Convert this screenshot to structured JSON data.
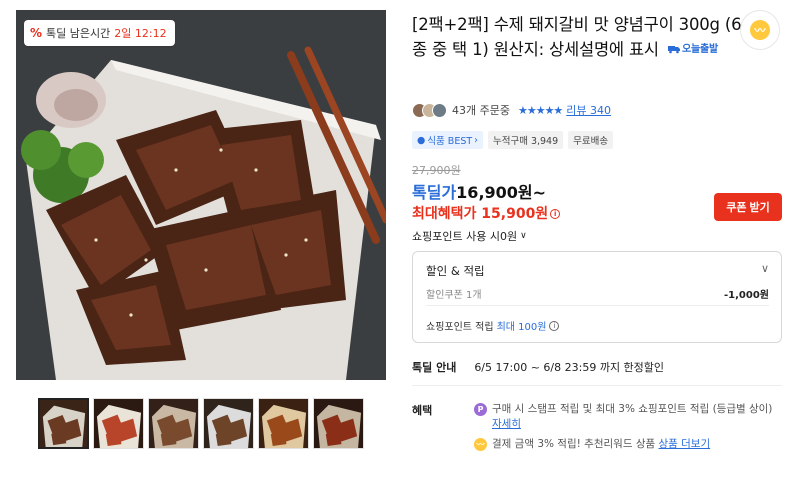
{
  "gallery": {
    "timer_label": "톡딜 남은시간",
    "timer_value": "2일 12:12",
    "thumbnails": [
      {
        "name": "thumb-1",
        "colors": [
          "#3a2418",
          "#6b3a22",
          "#d8d3c8"
        ]
      },
      {
        "name": "thumb-2",
        "colors": [
          "#2a1a12",
          "#b8442a",
          "#e9e3d8"
        ]
      },
      {
        "name": "thumb-3",
        "colors": [
          "#332018",
          "#7a4a2e",
          "#c9b9a4"
        ]
      },
      {
        "name": "thumb-4",
        "colors": [
          "#2f241c",
          "#6e4429",
          "#dcdcdc"
        ]
      },
      {
        "name": "thumb-5",
        "colors": [
          "#3b2112",
          "#9a4a1a",
          "#e0c9a0"
        ]
      },
      {
        "name": "thumb-6",
        "colors": [
          "#2a1812",
          "#8a2e18",
          "#c4b6a0"
        ]
      }
    ]
  },
  "product": {
    "title": "[2팩+2팩] 수제 돼지갈비 맛 양념구이 300g (6종 중 택 1) 원산지: 상세설명에 표시",
    "delivery_badge": "오늘출발",
    "order_count": "43개 주문중",
    "stars": "★★★★★",
    "review_link": "리뷰 340",
    "badges": [
      "식품 BEST",
      "누적구매 3,949",
      "무료배송"
    ],
    "original_price": "27,900원",
    "deal_label": "톡딜가",
    "deal_price": "16,900원~",
    "max_benefit_label": "최대혜택가",
    "max_benefit_price": "15,900원",
    "coupon_button": "쿠폰 받기",
    "points_use": "쇼핑포인트 사용 시0원"
  },
  "benefit_box": {
    "heading": "할인 & 적립",
    "coupon_label": "할인쿠폰 1개",
    "coupon_value": "-1,000원",
    "points_label": "쇼핑포인트 적립",
    "points_value": "최대 100원"
  },
  "deal_info": {
    "label": "톡딜 안내",
    "text": "6/5 17:00 ~ 6/8 23:59 까지 한정할인"
  },
  "benefits": {
    "label": "혜택",
    "item1_text": "구매 시 스탬프 적립 및 최대 3% 쇼핑포인트 적립 (등급별 상이)",
    "item1_link": "자세히",
    "item2_text": "결제 금액 3% 적립! 추천리워드 상품",
    "item2_link": "상품 더보기"
  },
  "colors": {
    "accent_blue": "#2a6dd8",
    "accent_red": "#e8321e",
    "point_purple": "#9b6bd6",
    "point_yellow": "#ffc83d"
  }
}
